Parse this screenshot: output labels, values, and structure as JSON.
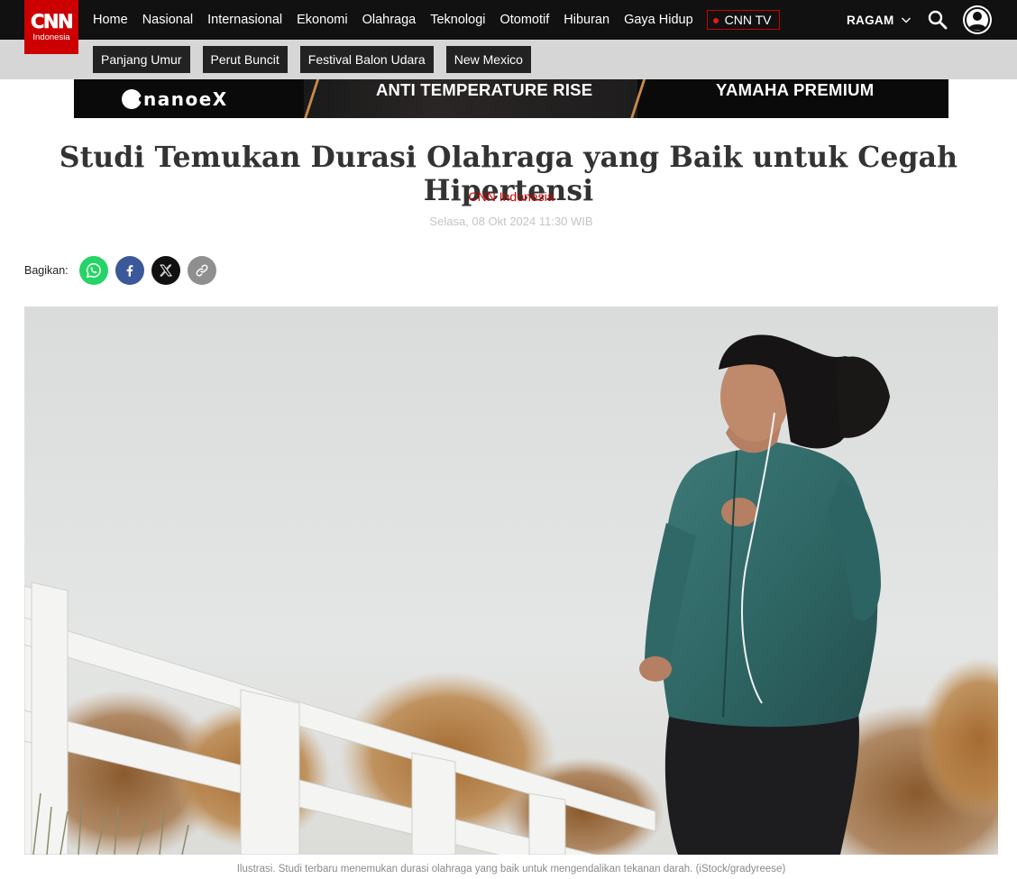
{
  "brand": {
    "logo_text": "CNN",
    "logo_sub": "Indonesia",
    "logo_color": "#cc0000"
  },
  "nav": {
    "items": [
      {
        "label": "Home"
      },
      {
        "label": "Nasional"
      },
      {
        "label": "Internasional"
      },
      {
        "label": "Ekonomi"
      },
      {
        "label": "Olahraga"
      },
      {
        "label": "Teknologi"
      },
      {
        "label": "Otomotif"
      },
      {
        "label": "Hiburan"
      },
      {
        "label": "Gaya Hidup"
      }
    ],
    "live": {
      "label": "CNN TV"
    },
    "more": {
      "label": "RAGAM"
    },
    "search_icon": "search-icon",
    "user_icon": "user-avatar-icon"
  },
  "trending_tags": [
    {
      "label": "Panjang Umur"
    },
    {
      "label": "Perut Buncit"
    },
    {
      "label": "Festival Balon Udara"
    },
    {
      "label": "New Mexico"
    }
  ],
  "ad": {
    "brand": "nanoeX",
    "text1": "ANTI TEMPERATURE RISE",
    "text2": "YAMAHA PREMIUM"
  },
  "article": {
    "title": "Studi Temukan Durasi Olahraga yang Baik untuk Cegah Hipertensi",
    "author": "CNN Indonesia",
    "date": "Selasa, 08 Okt 2024 11:30 WIB",
    "share_label": "Bagikan:",
    "share": [
      {
        "name": "whatsapp",
        "icon": "whatsapp-icon",
        "color": "#25d366"
      },
      {
        "name": "facebook",
        "icon": "facebook-icon",
        "color": "#3b5998"
      },
      {
        "name": "x",
        "icon": "x-icon",
        "color": "#111111"
      },
      {
        "name": "copy-link",
        "icon": "link-icon",
        "color": "#8f8f8f"
      }
    ],
    "image_caption": "Ilustrasi. Studi terbaru menemukan durasi olahraga yang baik untuk mengendalikan tekanan darah. (iStock/gradyreese)"
  }
}
